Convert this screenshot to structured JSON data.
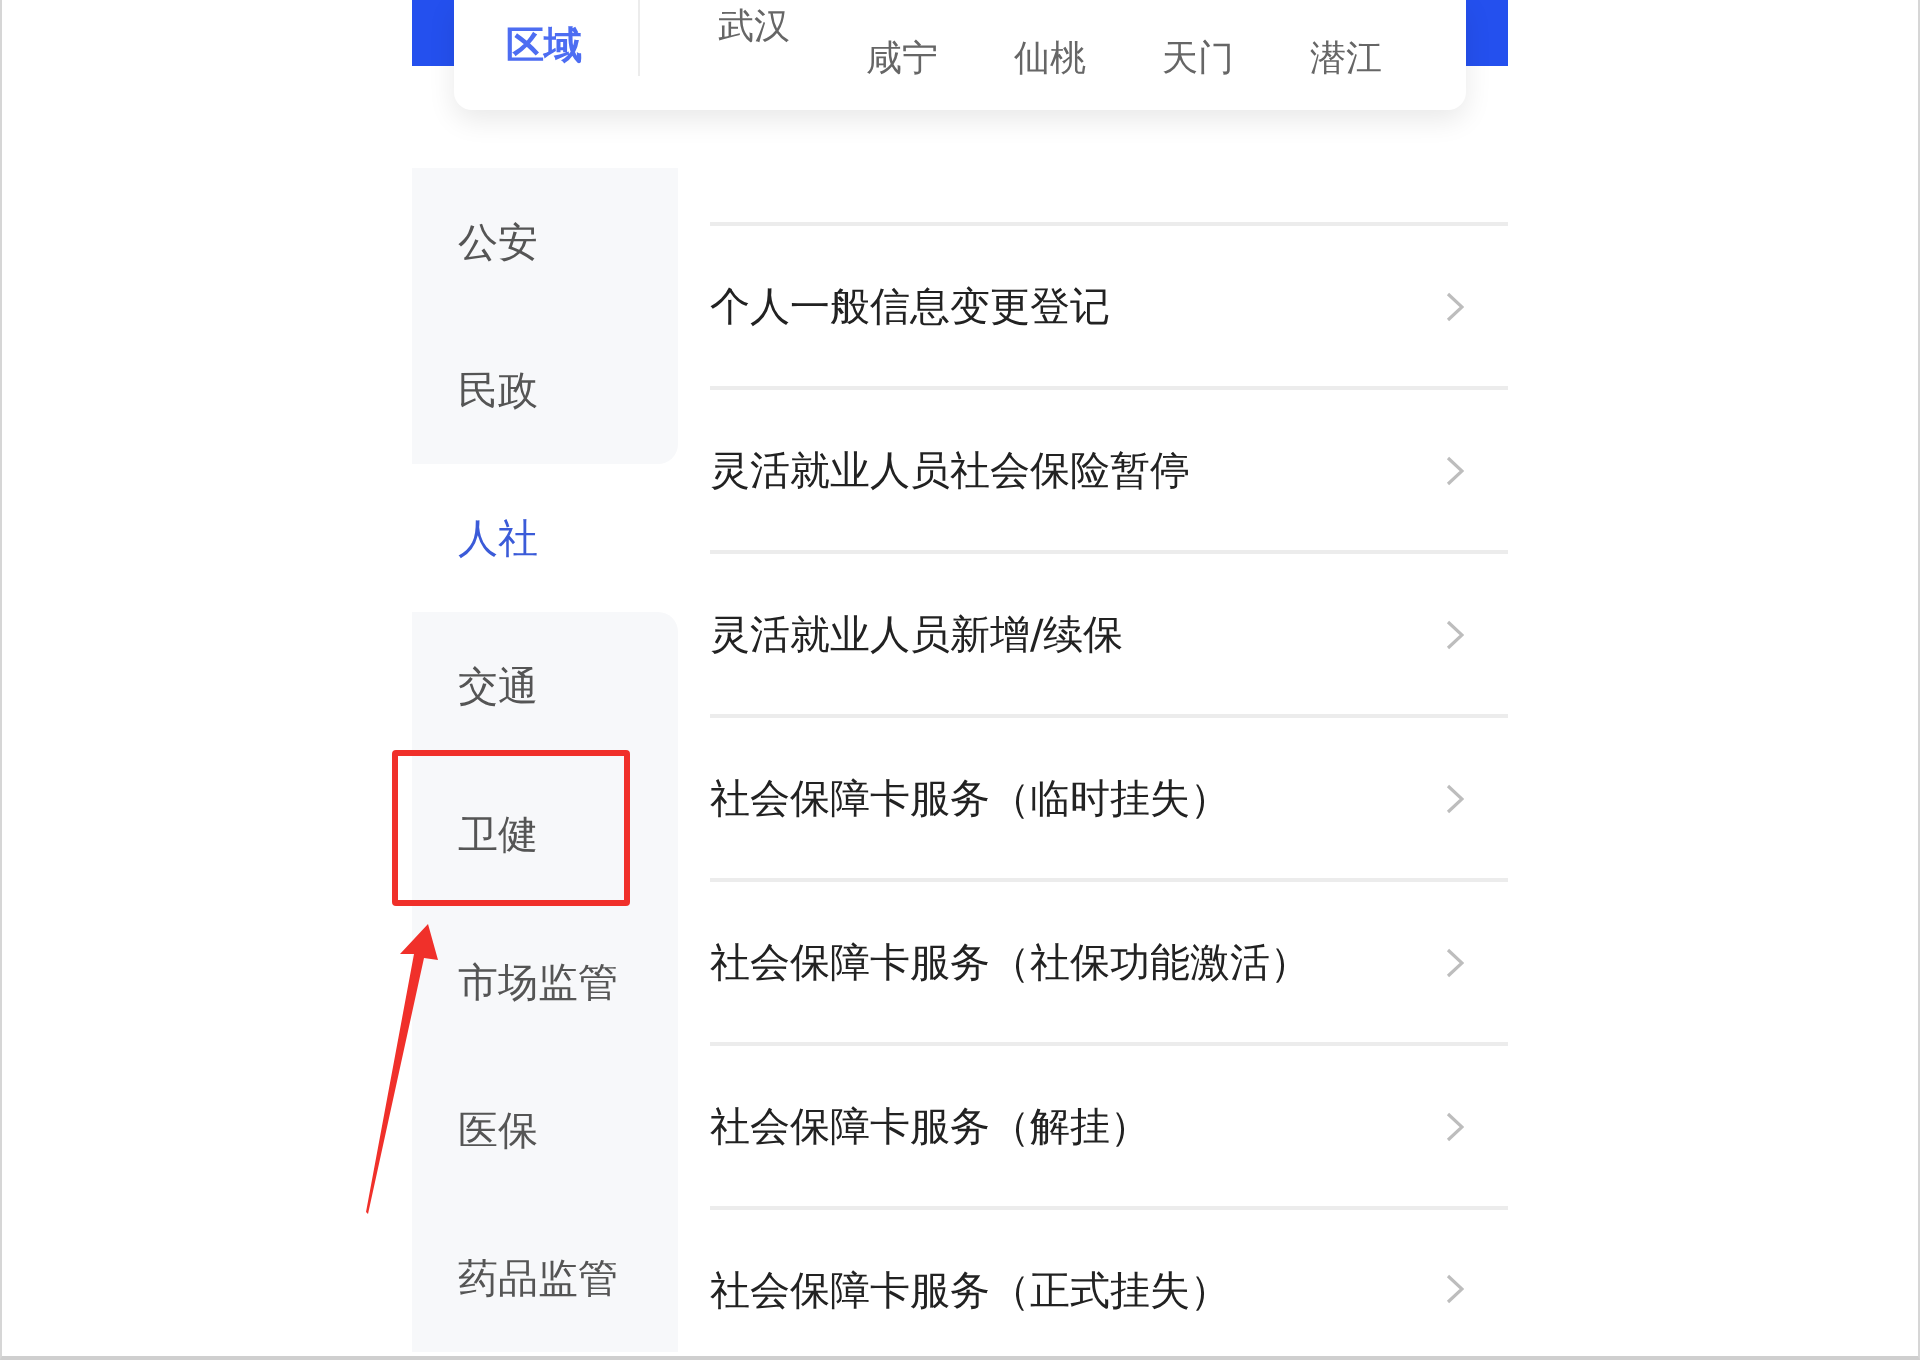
{
  "region_card": {
    "title": "区域",
    "featured_city": "武汉",
    "cities": [
      "咸宁",
      "仙桃",
      "天门",
      "潜江"
    ]
  },
  "sidebar": {
    "items": [
      {
        "label": "公安",
        "selected": false,
        "highlighted": false
      },
      {
        "label": "民政",
        "selected": false,
        "highlighted": false
      },
      {
        "label": "人社",
        "selected": true,
        "highlighted": false
      },
      {
        "label": "交通",
        "selected": false,
        "highlighted": false
      },
      {
        "label": "卫健",
        "selected": false,
        "highlighted": true
      },
      {
        "label": "市场监管",
        "selected": false,
        "highlighted": false
      },
      {
        "label": "医保",
        "selected": false,
        "highlighted": false
      },
      {
        "label": "药品监管",
        "selected": false,
        "highlighted": false
      }
    ]
  },
  "services": [
    {
      "title": "个人一般信息变更登记"
    },
    {
      "title": "灵活就业人员社会保险暂停"
    },
    {
      "title": "灵活就业人员新增/续保"
    },
    {
      "title": "社会保障卡服务（临时挂失）"
    },
    {
      "title": "社会保障卡服务（社保功能激活）"
    },
    {
      "title": "社会保障卡服务（解挂）"
    },
    {
      "title": "社会保障卡服务（正式挂失）"
    }
  ]
}
